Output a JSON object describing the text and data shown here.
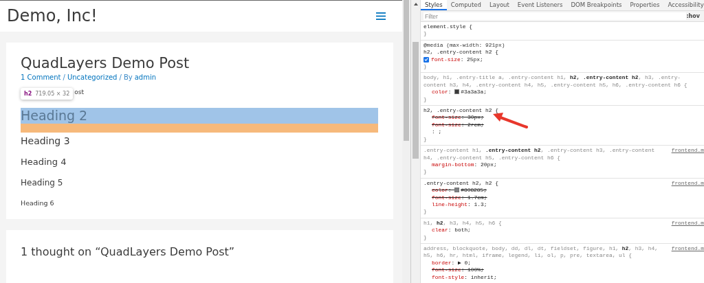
{
  "site": {
    "title": "Demo, Inc!"
  },
  "post": {
    "title": "QuadLayers Demo Post",
    "meta": [
      {
        "kind": "link",
        "text": "1 Comment"
      },
      {
        "kind": "sep",
        "text": "/"
      },
      {
        "kind": "link",
        "text": "Uncategorized"
      },
      {
        "kind": "sep",
        "text": "/ By"
      },
      {
        "kind": "link",
        "text": "admin"
      }
    ],
    "paragraph_visible": "ost",
    "tooltip": {
      "tag": "h2",
      "size": "719.05 × 32"
    },
    "headings": [
      {
        "kind": "h2",
        "text": "Heading 2",
        "highlighted": true
      },
      {
        "kind": "h3",
        "text": "Heading 3",
        "highlighted": false
      },
      {
        "kind": "h4",
        "text": "Heading 4",
        "highlighted": false
      },
      {
        "kind": "h5",
        "text": "Heading 5",
        "highlighted": false
      },
      {
        "kind": "h6",
        "text": "Heading 6",
        "highlighted": false
      }
    ]
  },
  "comments": {
    "title": "1 thought on “QuadLayers Demo Post”"
  },
  "devtools": {
    "tabs": [
      {
        "label": "Styles",
        "selected": true
      },
      {
        "label": "Computed",
        "selected": false
      },
      {
        "label": "Layout",
        "selected": false
      },
      {
        "label": "Event Listeners",
        "selected": false
      },
      {
        "label": "DOM Breakpoints",
        "selected": false
      },
      {
        "label": "Properties",
        "selected": false
      },
      {
        "label": "Accessibility",
        "selected": false
      }
    ],
    "filter": {
      "placeholder": "Filter"
    },
    "hov": ":hov",
    "rules": [
      {
        "selector": "element.style {",
        "dim": false,
        "close": "}"
      },
      {
        "media": "@media (max-width: 921px)",
        "selector": "h2, .entry-content h2 {",
        "dim": false,
        "decls": [
          {
            "kind": "plain",
            "name": "font-size",
            "colon": ":",
            "value": "25px;",
            "struck": false,
            "checked": true
          }
        ],
        "close": "}"
      },
      {
        "selector": "body, h1, .entry-title a, .entry-content h1, **h2, .entry-content h2**, h3, .entry-content h3, h4, .entry-content h4, h5, .entry-content h5, h6, .entry-content h6 {",
        "dim": true,
        "decls": [
          {
            "kind": "color",
            "name": "color",
            "colon": ":",
            "value": "#3a3a3a;",
            "struck": false
          }
        ],
        "close": "}"
      },
      {
        "selector": "h2, .entry-content h2 {",
        "dim": false,
        "arrow": true,
        "decls": [
          {
            "kind": "plain",
            "name": "font-size",
            "colon": ":",
            "value": "30px;",
            "struck": true
          },
          {
            "kind": "plain",
            "name": "font-size",
            "colon": ":",
            "value": "2rem;",
            "struck": true
          },
          {
            "kind": "edit",
            "text": ": ;"
          }
        ],
        "close": "}"
      },
      {
        "selector": ".entry-content h1, **.entry-content h2**, .entry-content h3, .entry-content h4, .entry-content h5, .entry-content h6 {",
        "source": "frontend.m",
        "dim": true,
        "decls": [
          {
            "kind": "plain",
            "name": "margin-bottom",
            "colon": ":",
            "value": "20px;",
            "struck": false
          }
        ],
        "close": "}"
      },
      {
        "selector": ".entry-content h2, h2 {",
        "source": "frontend.m",
        "dim": false,
        "decls": [
          {
            "kind": "color",
            "name": "color",
            "colon": ":",
            "value": "#808285;",
            "struck": true
          },
          {
            "kind": "plain",
            "name": "font-size",
            "colon": ":",
            "value": "1.7em;",
            "struck": true
          },
          {
            "kind": "plain",
            "name": "line-height",
            "colon": ":",
            "value": "1.3;",
            "struck": false
          }
        ],
        "close": "}"
      },
      {
        "selector": "h1, **h2**, h3, h4, h5, h6 {",
        "source": "frontend.m",
        "dim": true,
        "decls": [
          {
            "kind": "plain",
            "name": "clear",
            "colon": ":",
            "value": "both;",
            "struck": false
          }
        ],
        "close": "}"
      },
      {
        "selector": "address, blockquote, body, dd, dl, dt, fieldset, figure, h1, **h2**, h3, h4, h5, h6, hr, html, iframe, legend, li, ol, p, pre, textarea, ul {",
        "source": "frontend.m",
        "dim": true,
        "decls": [
          {
            "kind": "plain",
            "name": "border",
            "colon": ":",
            "value": "▶ 0;",
            "struck": false
          },
          {
            "kind": "plain",
            "name": "font-size",
            "colon": ":",
            "value": "100%;",
            "struck": true
          },
          {
            "kind": "plain",
            "name": "font-style",
            "colon": ":",
            "value": "inherit;",
            "struck": false
          }
        ]
      }
    ]
  }
}
